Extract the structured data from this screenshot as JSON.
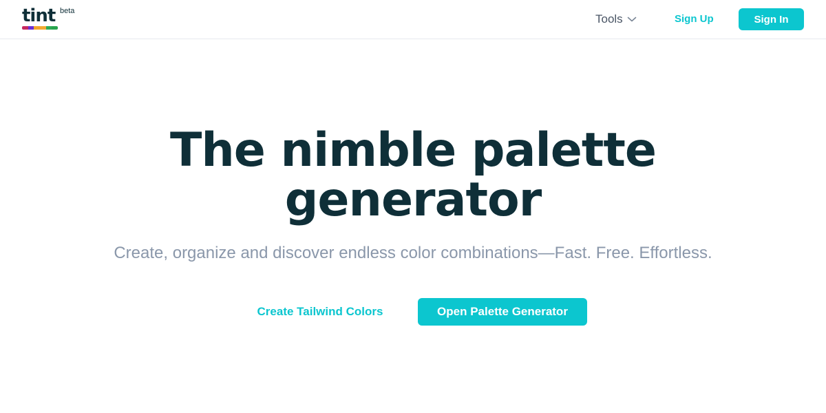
{
  "brand": {
    "name": "tint",
    "badge": "beta",
    "stripe_colors": [
      "#c62a60",
      "#6a2fd6",
      "#f1a62b",
      "#f2a933",
      "#2faa55",
      "#27a34d"
    ],
    "text_color": "#0f2f38",
    "accent_color": "#0cc6cf"
  },
  "nav": {
    "tools_label": "Tools",
    "tools_icon": "chevron-down-icon",
    "signup_label": "Sign Up",
    "signin_label": "Sign In"
  },
  "hero": {
    "title_line1": "The nimble palette",
    "title_line2": "generator",
    "subtitle": "Create, organize and discover endless color combinations—Fast. Free. Effortless.",
    "secondary_cta": "Create Tailwind Colors",
    "primary_cta": "Open Palette Generator"
  }
}
